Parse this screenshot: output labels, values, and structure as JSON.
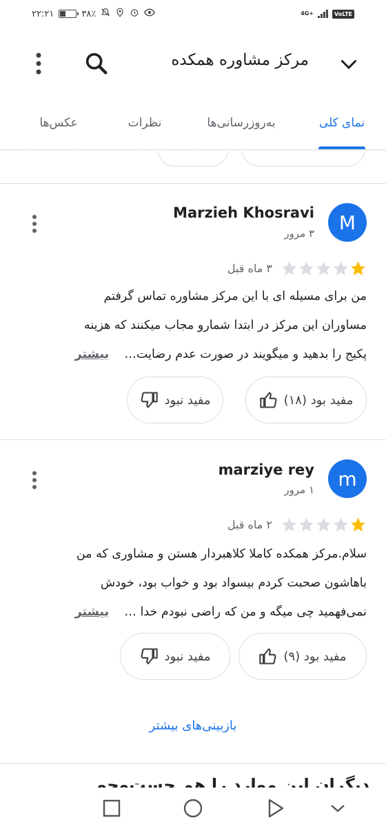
{
  "status_bar": {
    "time": "۲۲:۲۱",
    "battery": "۳۸٪",
    "battery_level": 0.38,
    "network": "4G+",
    "volte": "VoLTE"
  },
  "header": {
    "title": "مرکز مشاوره همکده"
  },
  "tabs": [
    {
      "label": "نمای کلی",
      "active": true
    },
    {
      "label": "به‌روزرسانی‌ها",
      "active": false
    },
    {
      "label": "نظرات",
      "active": false
    },
    {
      "label": "عکس‌ها",
      "active": false
    }
  ],
  "reviews": [
    {
      "avatar_letter": "M",
      "name": "Marzieh Khosravi",
      "review_count": "۳ مرور",
      "rating": 1,
      "max_rating": 5,
      "time": "۳ ماه قبل",
      "lines": [
        "من برای مسیله ای با این مرکز مشاوره تماس گرفتم",
        "مساوران این مرکز در ابتدا شمارو مجاب میکنند که هزینه",
        "پکیج را بدهید و میگویند در صورت عدم رضایت…"
      ],
      "more": "بیشتر",
      "helpful": "مفید بود (۱۸)",
      "not_helpful": "مفید نبود"
    },
    {
      "avatar_letter": "m",
      "name": "marziye rey",
      "review_count": "۱ مرور",
      "rating": 1,
      "max_rating": 5,
      "time": "۲ ماه قبل",
      "lines": [
        "سلام.مرکز همکده کاملا کلاهبردار هستن و مشاوری که من",
        "باهاشون صحبت کردم بیسواد بود و خواب بود، خودش",
        "نمی‌فهمید چی میگه و من که راضی نبودم خدا …"
      ],
      "more": "بیشتر",
      "helpful": "مفید بود (۹)",
      "not_helpful": "مفید نبود"
    }
  ],
  "more_reviews": "بازبینی‌های بیشتر",
  "next_section_title": "دیگران این موارد را هم جست‌وجو",
  "colors": {
    "accent": "#1a73e8",
    "star_filled": "#fbbc04",
    "star_empty": "#dadce0",
    "text": "#202124",
    "secondary": "#5f6368"
  }
}
